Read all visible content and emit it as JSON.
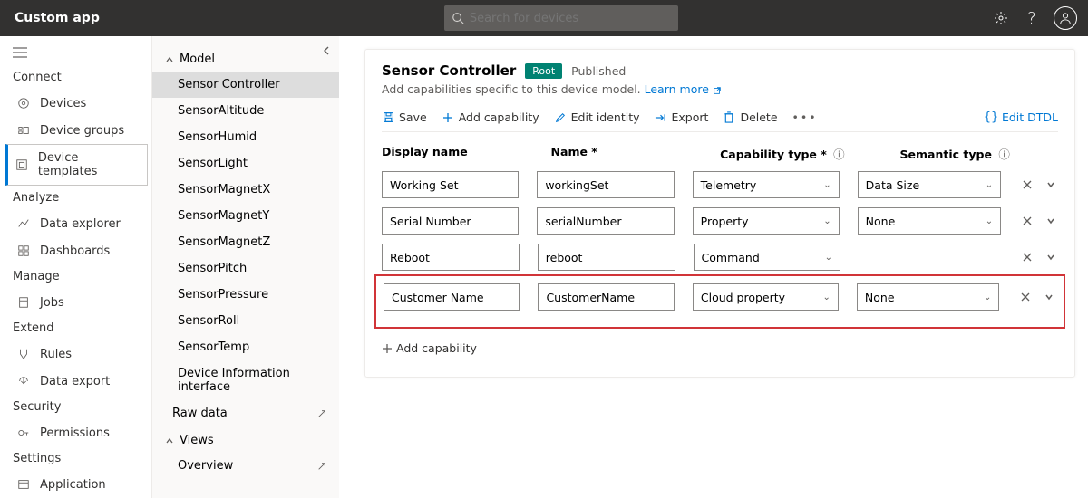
{
  "top": {
    "title": "Custom app",
    "search_placeholder": "Search for devices"
  },
  "nav": {
    "sections": [
      "Connect",
      "Analyze",
      "Manage",
      "Extend",
      "Security",
      "Settings"
    ],
    "items": {
      "devices": "Devices",
      "device_groups": "Device groups",
      "device_templates": "Device templates",
      "data_explorer": "Data explorer",
      "dashboards": "Dashboards",
      "jobs": "Jobs",
      "rules": "Rules",
      "data_export": "Data export",
      "permissions": "Permissions",
      "application": "Application"
    }
  },
  "tree": {
    "model": "Model",
    "items": [
      "Sensor Controller",
      "SensorAltitude",
      "SensorHumid",
      "SensorLight",
      "SensorMagnetX",
      "SensorMagnetY",
      "SensorMagnetZ",
      "SensorPitch",
      "SensorPressure",
      "SensorRoll",
      "SensorTemp",
      "Device Information interface"
    ],
    "raw_data": "Raw data",
    "views": "Views",
    "overview": "Overview"
  },
  "content": {
    "title": "Sensor Controller",
    "root": "Root",
    "published": "Published",
    "sub": "Add capabilities specific to this device model.",
    "learn_more": "Learn more",
    "toolbar": {
      "save": "Save",
      "add_cap": "Add capability",
      "edit_identity": "Edit identity",
      "export": "Export",
      "delete": "Delete",
      "edit_dtdl": "Edit DTDL"
    },
    "headers": {
      "display_name": "Display name",
      "name": "Name *",
      "cap_type": "Capability type *",
      "sem_type": "Semantic type"
    },
    "rows": [
      {
        "dn": "Working Set",
        "nm": "workingSet",
        "ct": "Telemetry",
        "st": "Data Size",
        "has_st": true
      },
      {
        "dn": "Serial Number",
        "nm": "serialNumber",
        "ct": "Property",
        "st": "None",
        "has_st": true
      },
      {
        "dn": "Reboot",
        "nm": "reboot",
        "ct": "Command",
        "st": "",
        "has_st": false
      },
      {
        "dn": "Customer Name",
        "nm": "CustomerName",
        "ct": "Cloud property",
        "st": "None",
        "has_st": true
      }
    ],
    "add_cap": "Add capability"
  }
}
